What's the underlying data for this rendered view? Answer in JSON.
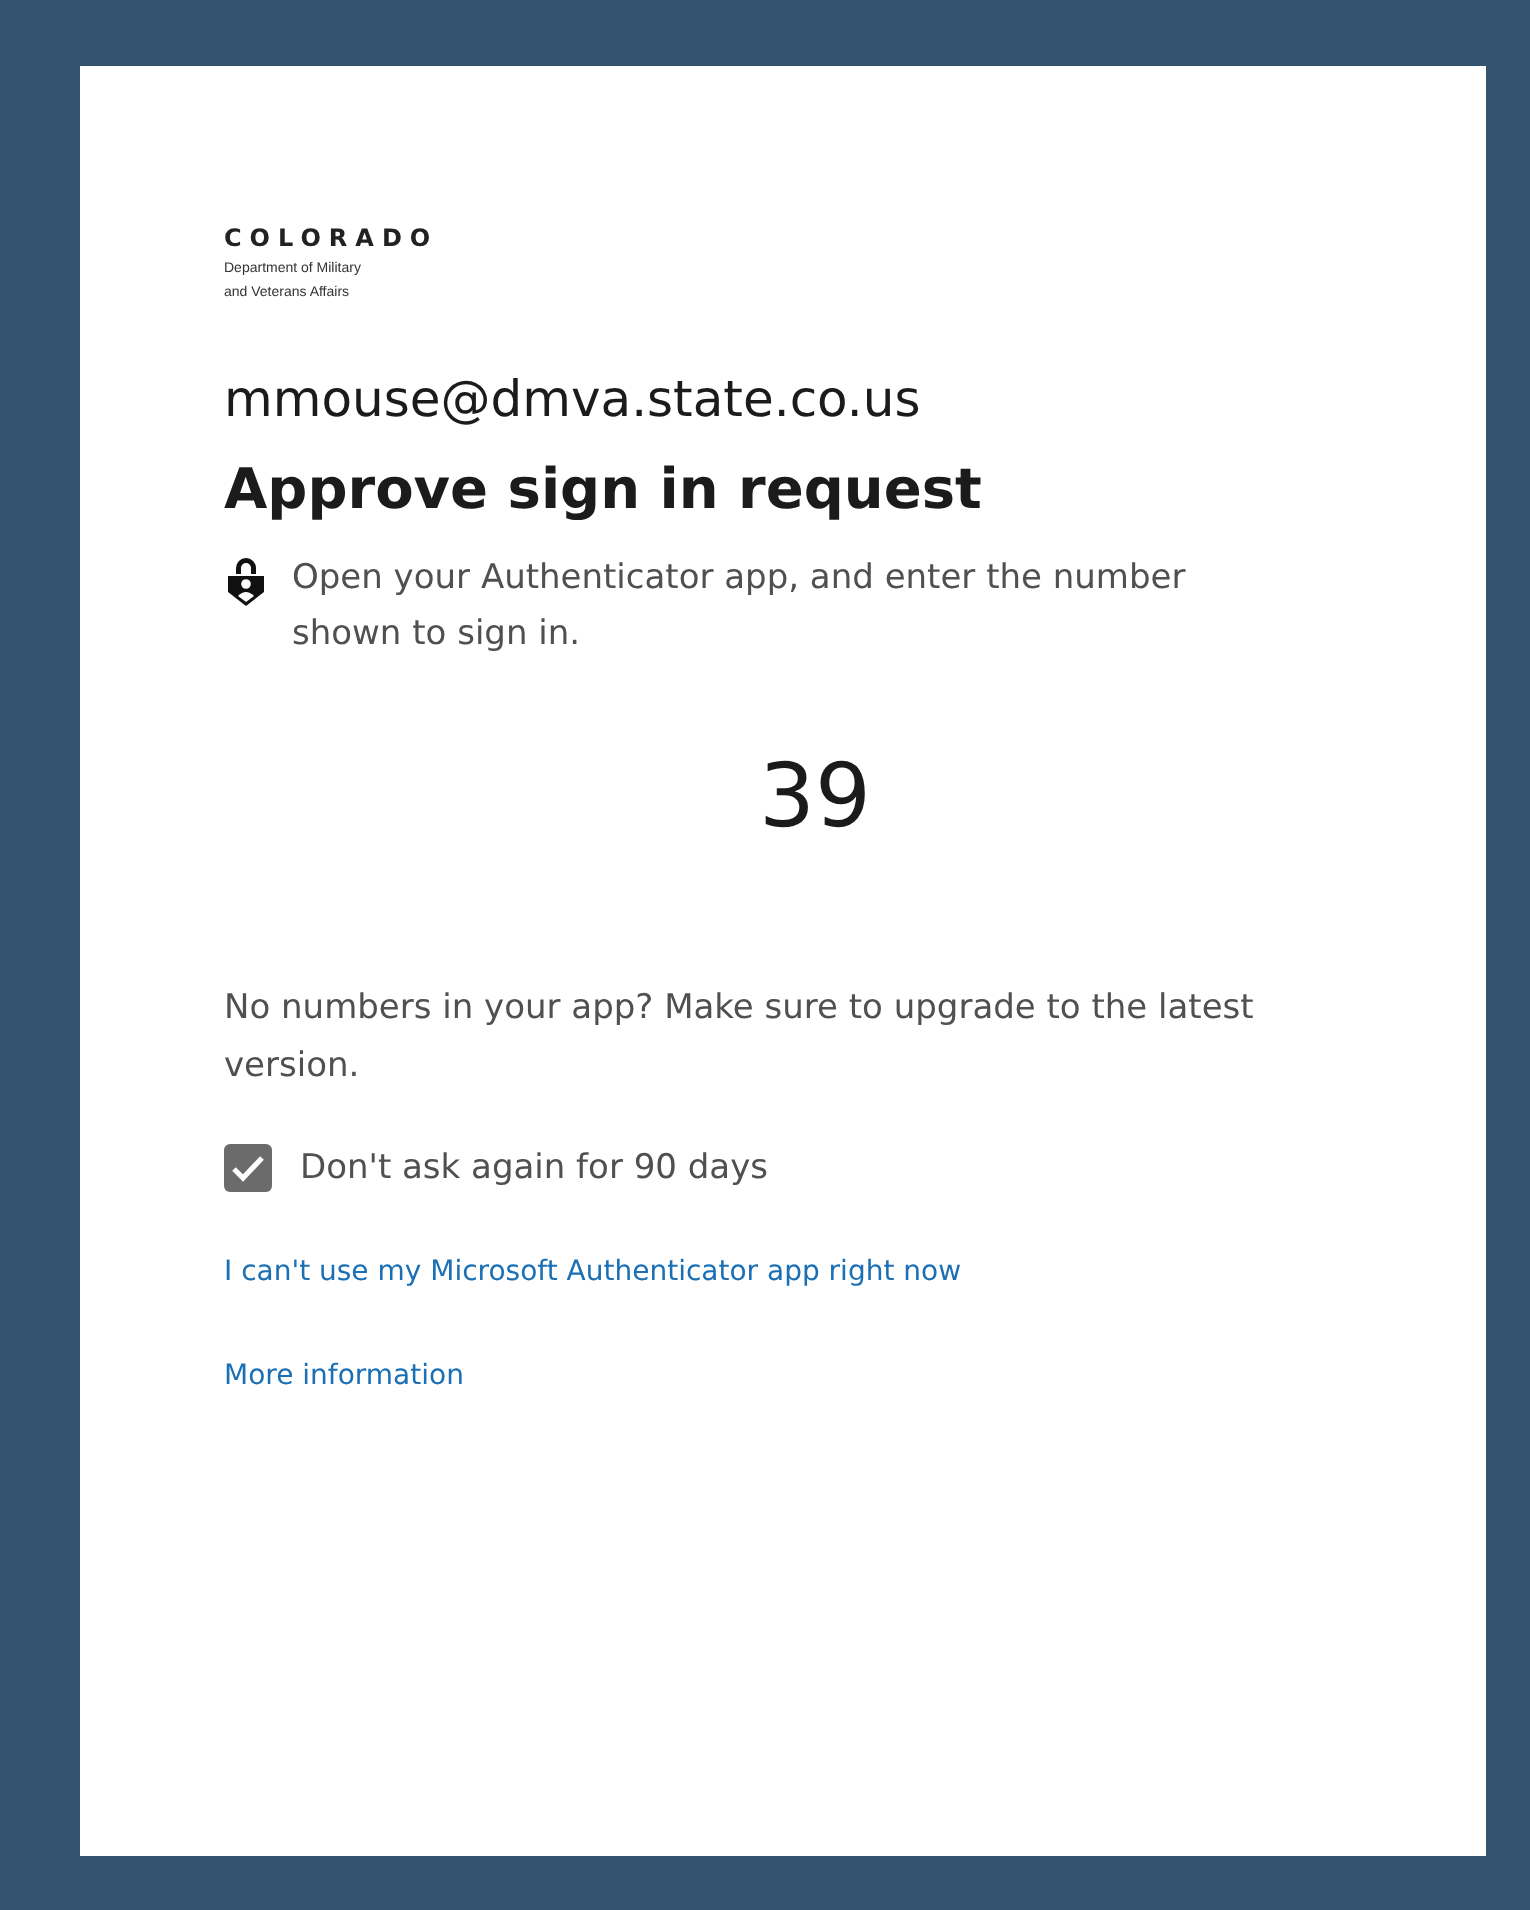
{
  "logo": {
    "name": "COLORADO",
    "subtitle_lines": [
      "Department of Military",
      "and Veterans Affairs"
    ]
  },
  "account": "mmouse@dmva.state.co.us",
  "title": "Approve sign in request",
  "instruction": "Open your Authenticator app, and enter the number shown to sign in.",
  "number": "39",
  "note": "No numbers in your app? Make sure to upgrade to the latest version.",
  "remember": {
    "label": "Don't ask again for 90 days",
    "checked": true
  },
  "links": [
    "I can't use my Microsoft Authenticator app right now",
    "More information"
  ]
}
